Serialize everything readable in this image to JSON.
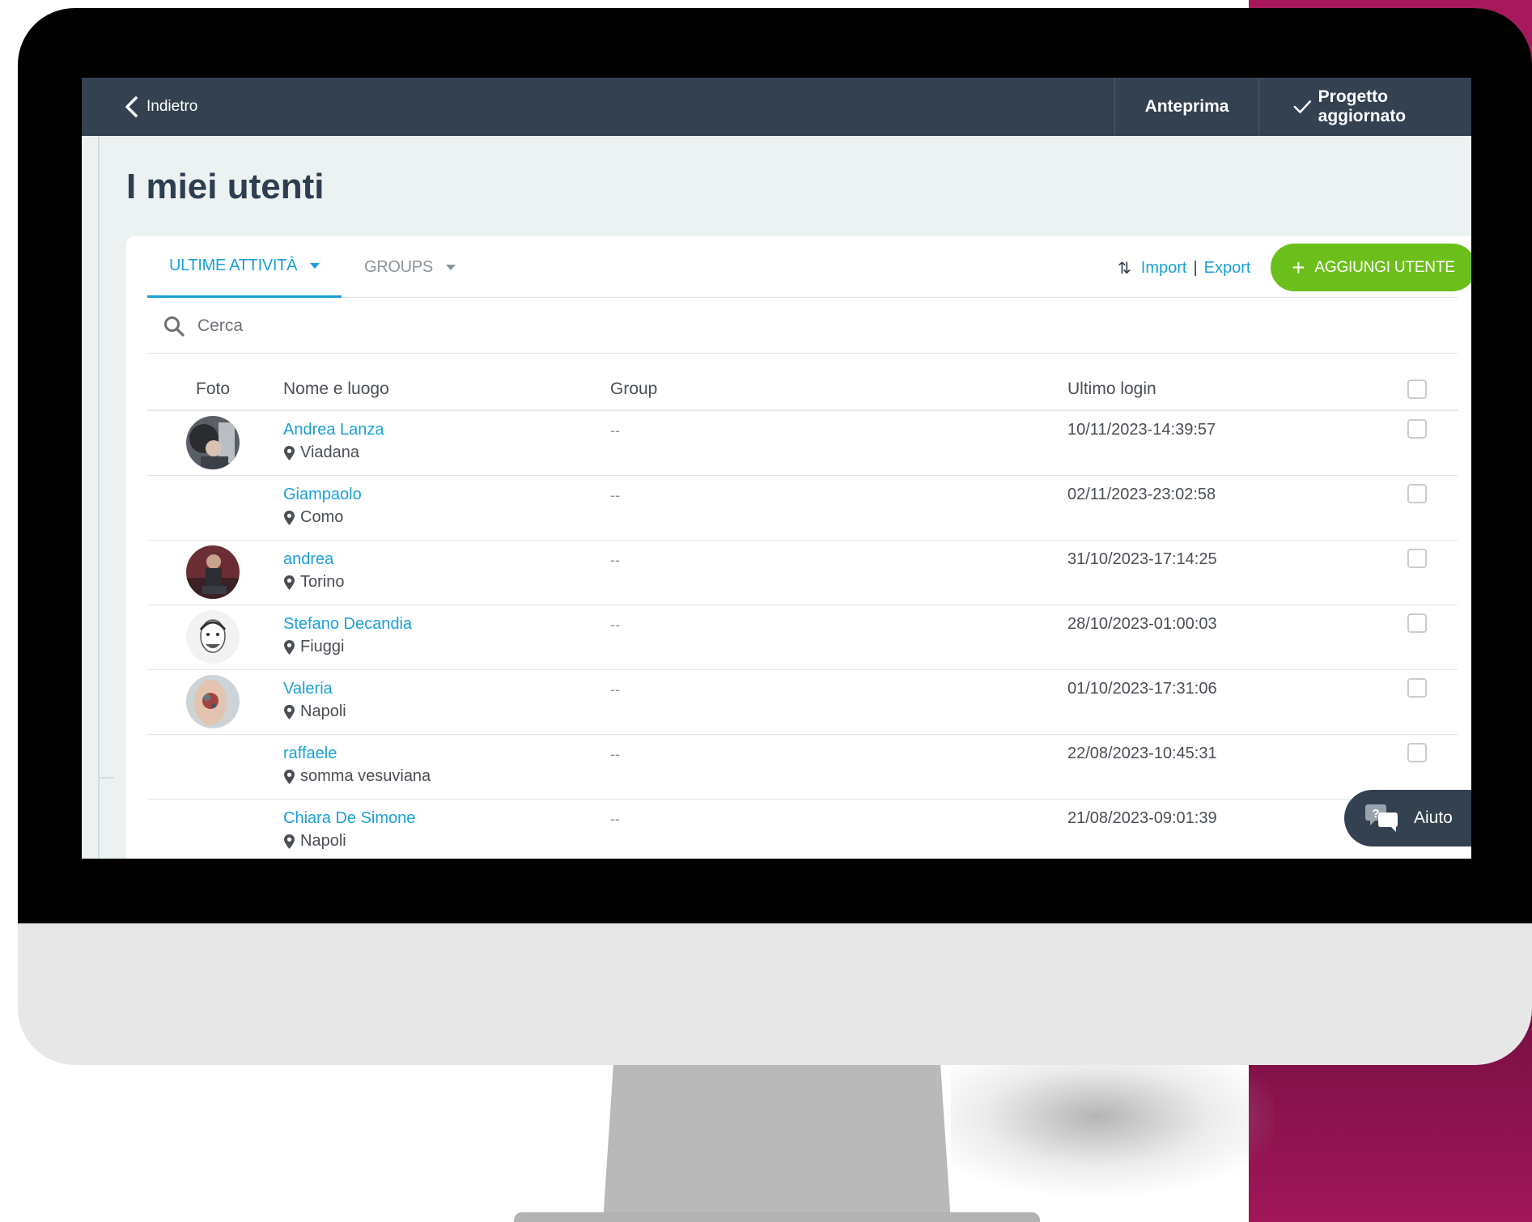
{
  "topbar": {
    "back_label": "Indietro",
    "preview_label": "Anteprima",
    "saved_label": "Progetto aggiornato"
  },
  "page": {
    "title": "I miei utenti"
  },
  "tabs": [
    {
      "label": "ULTIME ATTIVITÀ",
      "active": true
    },
    {
      "label": "GROUPS",
      "active": false
    }
  ],
  "actions": {
    "import_label": "Import",
    "separator": "|",
    "export_label": "Export",
    "add_user_label": "AGGIUNGI UTENTE"
  },
  "search": {
    "placeholder": "Cerca",
    "value": ""
  },
  "table": {
    "headers": {
      "foto": "Foto",
      "name": "Nome e luogo",
      "group": "Group",
      "login": "Ultimo login"
    },
    "rows": [
      {
        "name": "Andrea Lanza",
        "place": "Viadana",
        "group": "--",
        "last_login": "10/11/2023-14:39:57",
        "has_avatar": true
      },
      {
        "name": "Giampaolo",
        "place": "Como",
        "group": "--",
        "last_login": "02/11/2023-23:02:58",
        "has_avatar": false
      },
      {
        "name": "andrea",
        "place": "Torino",
        "group": "--",
        "last_login": "31/10/2023-17:14:25",
        "has_avatar": true
      },
      {
        "name": "Stefano Decandia",
        "place": "Fiuggi",
        "group": "--",
        "last_login": "28/10/2023-01:00:03",
        "has_avatar": true
      },
      {
        "name": "Valeria",
        "place": "Napoli",
        "group": "--",
        "last_login": "01/10/2023-17:31:06",
        "has_avatar": true
      },
      {
        "name": "raffaele",
        "place": "somma vesuviana",
        "group": "--",
        "last_login": "22/08/2023-10:45:31",
        "has_avatar": false
      },
      {
        "name": "Chiara De Simone",
        "place": "Napoli",
        "group": "--",
        "last_login": "21/08/2023-09:01:39",
        "has_avatar": false
      }
    ]
  },
  "help": {
    "label": "Aiuto",
    "icon_glyph": "?"
  },
  "colors": {
    "topbar": "#334150",
    "accent_blue": "#1aa0d6",
    "add_button_green": "#6cbf1a",
    "page_background": "#ecf1f1",
    "backdrop_magenta": "#a8195c"
  },
  "icons": {
    "back": "chevron-left-icon",
    "saved": "checkmark-icon",
    "sort": "sort-arrows-icon",
    "search": "search-icon",
    "place": "map-pin-icon",
    "help": "chat-help-icon"
  }
}
